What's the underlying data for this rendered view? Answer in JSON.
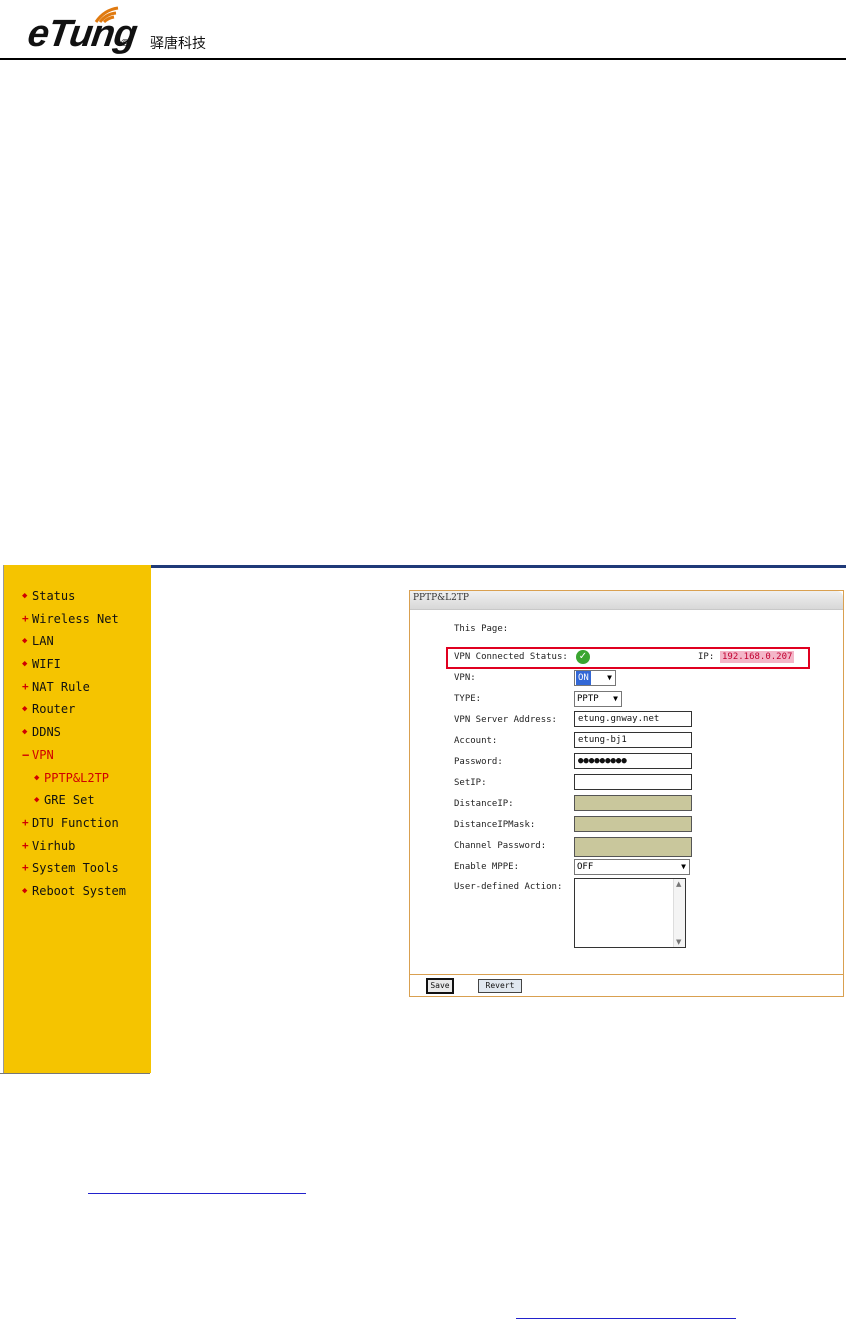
{
  "brand": {
    "logo_text": "eTung",
    "registered_mark": "®",
    "company_name": "驿唐科技"
  },
  "sidebar": {
    "items": [
      {
        "label": "Status",
        "marker": "dot"
      },
      {
        "label": "Wireless Net",
        "marker": "plus"
      },
      {
        "label": "LAN",
        "marker": "dot"
      },
      {
        "label": "WIFI",
        "marker": "dot"
      },
      {
        "label": "NAT Rule",
        "marker": "plus"
      },
      {
        "label": "Router",
        "marker": "dot"
      },
      {
        "label": "DDNS",
        "marker": "dot"
      },
      {
        "label": "VPN",
        "marker": "minus",
        "active": true
      },
      {
        "label": "PPTP&L2TP",
        "marker": "dot",
        "sub": true,
        "active": true
      },
      {
        "label": "GRE Set",
        "marker": "dot",
        "sub": true
      },
      {
        "label": "DTU Function",
        "marker": "plus"
      },
      {
        "label": "Virhub",
        "marker": "plus"
      },
      {
        "label": "System Tools",
        "marker": "plus"
      },
      {
        "label": "Reboot System",
        "marker": "dot"
      }
    ]
  },
  "panel": {
    "title": "PPTP&L2TP",
    "this_page_label": "This Page:",
    "status_label": "VPN Connected Status:",
    "ip_label": "IP:",
    "ip_value": "192.168.0.207",
    "vpn_label": "VPN:",
    "vpn_value": "ON",
    "type_label": "TYPE:",
    "type_value": "PPTP",
    "server_label": "VPN Server Address:",
    "server_value": "etung.gnway.net",
    "account_label": "Account:",
    "account_value": "etung-bj1",
    "password_label": "Password:",
    "password_value": "●●●●●●●●●",
    "setip_label": "SetIP:",
    "setip_value": "",
    "distanceip_label": "DistanceIP:",
    "distancemask_label": "DistanceIPMask:",
    "channel_label": "Channel Password:",
    "mppe_label": "Enable MPPE:",
    "mppe_value": "OFF",
    "action_label": "User-defined Action:",
    "save_label": "Save",
    "revert_label": "Revert"
  },
  "colors": {
    "sidebar_bg": "#f5c400",
    "accent_red": "#d00000",
    "header_rule": "#1f3a78",
    "panel_border": "#d9a050"
  }
}
